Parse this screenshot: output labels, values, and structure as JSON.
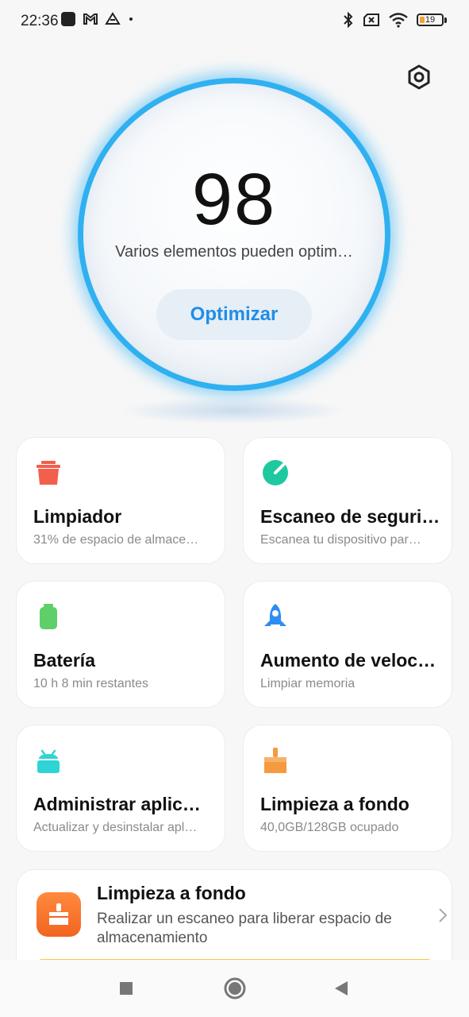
{
  "status_bar": {
    "time": "22:36",
    "battery_level": "19",
    "icons": [
      "square-app-icon",
      "gmail-icon",
      "drive-icon",
      "dot-icon",
      "bluetooth-icon",
      "no-sim-icon",
      "wifi-icon",
      "battery-icon"
    ]
  },
  "header": {
    "settings_icon": "settings-hex-icon"
  },
  "score": {
    "value": "98",
    "description": "Varios elementos pueden optim…",
    "optimize_label": "Optimizar"
  },
  "cards": [
    {
      "title": "Limpiador",
      "subtitle": "31% de espacio de almace…",
      "icon": "trash-icon",
      "color": "#f25f4c"
    },
    {
      "title": "Escaneo de seguri…",
      "subtitle": "Escanea tu dispositivo par…",
      "icon": "security-scan-icon",
      "color": "#1ec9a0"
    },
    {
      "title": "Batería",
      "subtitle": "10 h 8 min  restantes",
      "icon": "battery-icon",
      "color": "#5fcf6a"
    },
    {
      "title": "Aumento de veloc…",
      "subtitle": "Limpiar memoria",
      "icon": "rocket-icon",
      "color": "#2d8ef2"
    },
    {
      "title": "Administrar aplic…",
      "subtitle": "Actualizar y desinstalar apl…",
      "icon": "android-icon",
      "color": "#2ed4d6"
    },
    {
      "title": "Limpieza a fondo",
      "subtitle": "40,0GB/128GB ocupado",
      "icon": "broom-icon",
      "color": "#f59a3e"
    }
  ],
  "banner": {
    "title": "Limpieza a fondo",
    "description": "Realizar un escaneo para liberar espacio de almacenamiento",
    "icon": "deep-clean-icon",
    "accent_color": "#f26420"
  },
  "nav": {
    "items": [
      "recents-icon",
      "home-icon",
      "back-icon"
    ]
  },
  "colors": {
    "ring": "#2fb0f0",
    "accent": "#1f8ee8"
  }
}
